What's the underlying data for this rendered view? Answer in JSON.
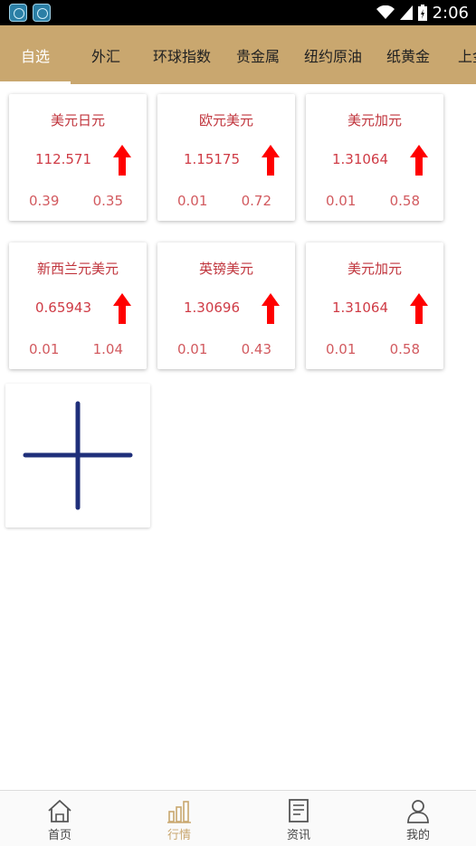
{
  "status_bar": {
    "time": "2:06"
  },
  "tabs": [
    {
      "label": "自选",
      "active": true
    },
    {
      "label": "外汇"
    },
    {
      "label": "环球指数"
    },
    {
      "label": "贵金属"
    },
    {
      "label": "纽约原油"
    },
    {
      "label": "纸黄金"
    },
    {
      "label": "上金"
    }
  ],
  "quotes": [
    {
      "name": "美元日元",
      "price": "112.571",
      "v1": "0.39",
      "v2": "0.35",
      "trend": "up"
    },
    {
      "name": "欧元美元",
      "price": "1.15175",
      "v1": "0.01",
      "v2": "0.72",
      "trend": "up"
    },
    {
      "name": "美元加元",
      "price": "1.31064",
      "v1": "0.01",
      "v2": "0.58",
      "trend": "up"
    },
    {
      "name": "新西兰元美元",
      "price": "0.65943",
      "v1": "0.01",
      "v2": "1.04",
      "trend": "up"
    },
    {
      "name": "英镑美元",
      "price": "1.30696",
      "v1": "0.01",
      "v2": "0.43",
      "trend": "up"
    },
    {
      "name": "美元加元",
      "price": "1.31064",
      "v1": "0.01",
      "v2": "0.58",
      "trend": "up"
    }
  ],
  "bottom_nav": [
    {
      "label": "首页",
      "icon": "home-icon"
    },
    {
      "label": "行情",
      "icon": "market-chart-icon",
      "active": true
    },
    {
      "label": "资讯",
      "icon": "news-icon"
    },
    {
      "label": "我的",
      "icon": "profile-icon"
    }
  ],
  "colors": {
    "tab_bar_bg": "#c9a76f",
    "quote_text": "#c0343c",
    "arrow_up": "#ff0000",
    "add_icon": "#1f2f7a"
  }
}
